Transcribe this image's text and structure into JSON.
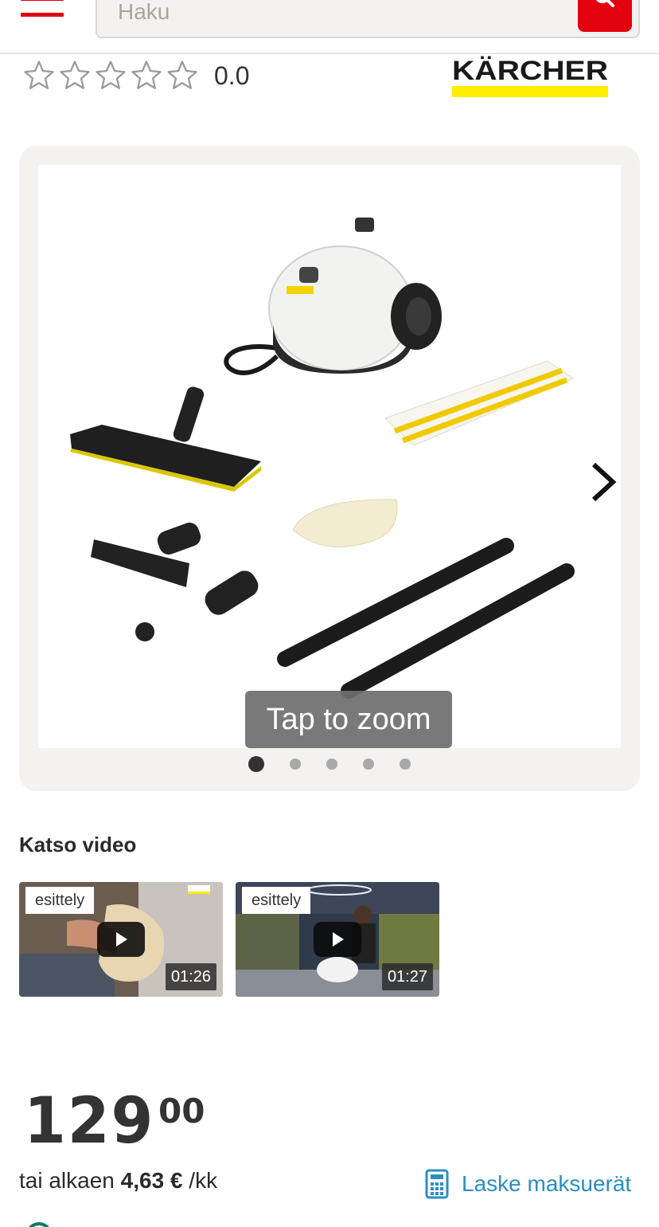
{
  "header": {
    "menu_icon": "hamburger-menu-icon",
    "search_placeholder": "Haku",
    "search_icon": "search-icon"
  },
  "rating": {
    "stars_total": 5,
    "stars_filled": 0,
    "value": "0.0"
  },
  "brand": {
    "name": "KÄRCHER",
    "color_text": "#1a1a1a",
    "color_accent": "#ffed00"
  },
  "gallery": {
    "zoom_hint": "Tap to zoom",
    "slides": 5,
    "active_slide": 1,
    "next_icon": "chevron-right-icon"
  },
  "videos": {
    "heading": "Katso video",
    "items": [
      {
        "badge": "esittely",
        "duration": "01:26"
      },
      {
        "badge": "esittely",
        "duration": "01:27"
      }
    ]
  },
  "price": {
    "integer": "129",
    "decimals": "00",
    "installment_prefix": "tai alkaen",
    "installment_amount": "4,63 €",
    "installment_suffix": "/kk",
    "calc_label": "Laske maksuerät",
    "calc_icon": "calculator-icon"
  },
  "colors": {
    "primary_red": "#e3000f",
    "link_blue": "#2a8fc0",
    "panel_bg": "#f4f2ef"
  }
}
